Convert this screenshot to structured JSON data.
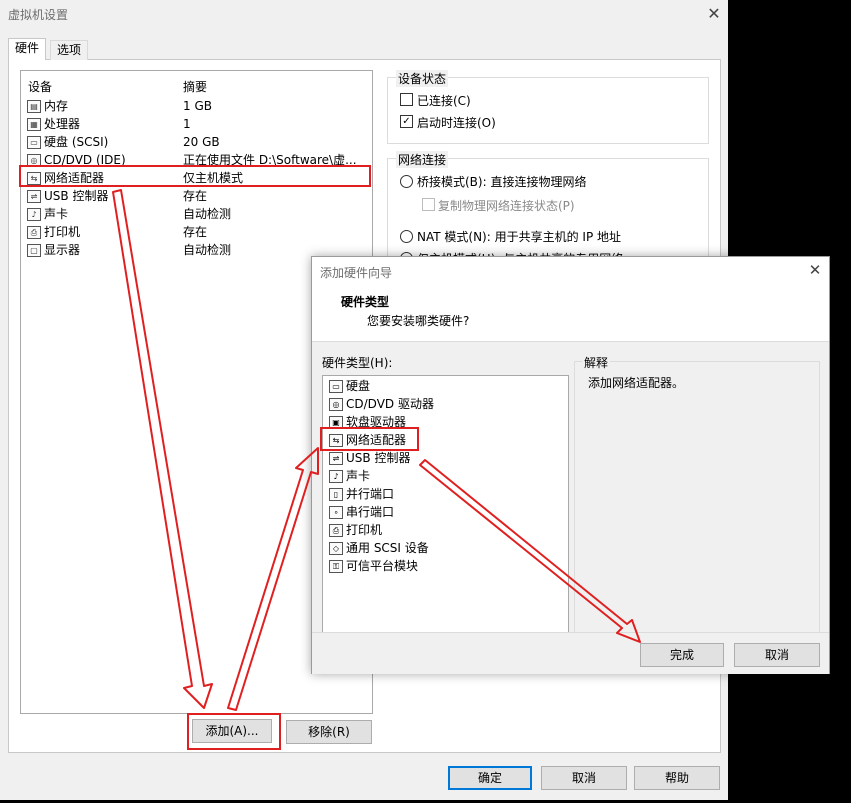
{
  "main_dialog": {
    "title": "虚拟机设置",
    "close_glyph": "✕",
    "tabs": [
      {
        "label": "硬件",
        "active": true
      },
      {
        "label": "选项",
        "active": false
      }
    ],
    "device_table": {
      "col_device": "设备",
      "col_summary": "摘要",
      "rows": [
        {
          "icon": "memory-icon",
          "glyph": "▤",
          "name": "内存",
          "summary": "1 GB"
        },
        {
          "icon": "cpu-icon",
          "glyph": "▦",
          "name": "处理器",
          "summary": "1"
        },
        {
          "icon": "disk-icon",
          "glyph": "▭",
          "name": "硬盘 (SCSI)",
          "summary": "20 GB"
        },
        {
          "icon": "cd-icon",
          "glyph": "◎",
          "name": "CD/DVD (IDE)",
          "summary": "正在使用文件 D:\\Software\\虚..."
        },
        {
          "icon": "network-icon",
          "glyph": "⇆",
          "name": "网络适配器",
          "summary": "仅主机模式",
          "selected": true
        },
        {
          "icon": "usb-icon",
          "glyph": "⇌",
          "name": "USB 控制器",
          "summary": "存在"
        },
        {
          "icon": "sound-icon",
          "glyph": "♪",
          "name": "声卡",
          "summary": "自动检测"
        },
        {
          "icon": "printer-icon",
          "glyph": "⎙",
          "name": "打印机",
          "summary": "存在"
        },
        {
          "icon": "display-icon",
          "glyph": "▢",
          "name": "显示器",
          "summary": "自动检测"
        }
      ]
    },
    "device_status": {
      "title": "设备状态",
      "connected": {
        "label": "已连接(C)",
        "checked": false
      },
      "connect_on_power": {
        "label": "启动时连接(O)",
        "checked": true
      }
    },
    "network_connection": {
      "title": "网络连接",
      "bridged": "桥接模式(B): 直接连接物理网络",
      "replicate": "复制物理网络连接状态(P)",
      "nat": "NAT 模式(N): 用于共享主机的 IP 地址",
      "host_only_partial": "仅主机模式(H): 与主机共享的专用网络"
    },
    "buttons": {
      "add": "添加(A)...",
      "remove": "移除(R)",
      "ok": "确定",
      "cancel": "取消",
      "help": "帮助"
    }
  },
  "wizard": {
    "title": "添加硬件向导",
    "close_glyph": "✕",
    "heading": "硬件类型",
    "subheading": "您要安装哪类硬件?",
    "list_label": "硬件类型(H):",
    "explain_label": "解释",
    "explain_text": "添加网络适配器。",
    "hardware_types": [
      {
        "icon": "disk-icon",
        "glyph": "▭",
        "label": "硬盘"
      },
      {
        "icon": "cd-icon",
        "glyph": "◎",
        "label": "CD/DVD 驱动器"
      },
      {
        "icon": "floppy-icon",
        "glyph": "▣",
        "label": "软盘驱动器"
      },
      {
        "icon": "network-icon",
        "glyph": "⇆",
        "label": "网络适配器",
        "selected": true
      },
      {
        "icon": "usb-icon",
        "glyph": "⇌",
        "label": "USB 控制器"
      },
      {
        "icon": "sound-icon",
        "glyph": "♪",
        "label": "声卡"
      },
      {
        "icon": "parallel-port-icon",
        "glyph": "▯",
        "label": "并行端口"
      },
      {
        "icon": "serial-port-icon",
        "glyph": "∘",
        "label": "串行端口"
      },
      {
        "icon": "printer-icon",
        "glyph": "⎙",
        "label": "打印机"
      },
      {
        "icon": "scsi-icon",
        "glyph": "◇",
        "label": "通用 SCSI 设备"
      },
      {
        "icon": "tpm-icon",
        "glyph": "⚿",
        "label": "可信平台模块"
      }
    ],
    "buttons": {
      "finish": "完成",
      "cancel": "取消"
    }
  },
  "colors": {
    "annotation_red": "#e02020",
    "focus_blue": "#0078d7"
  }
}
